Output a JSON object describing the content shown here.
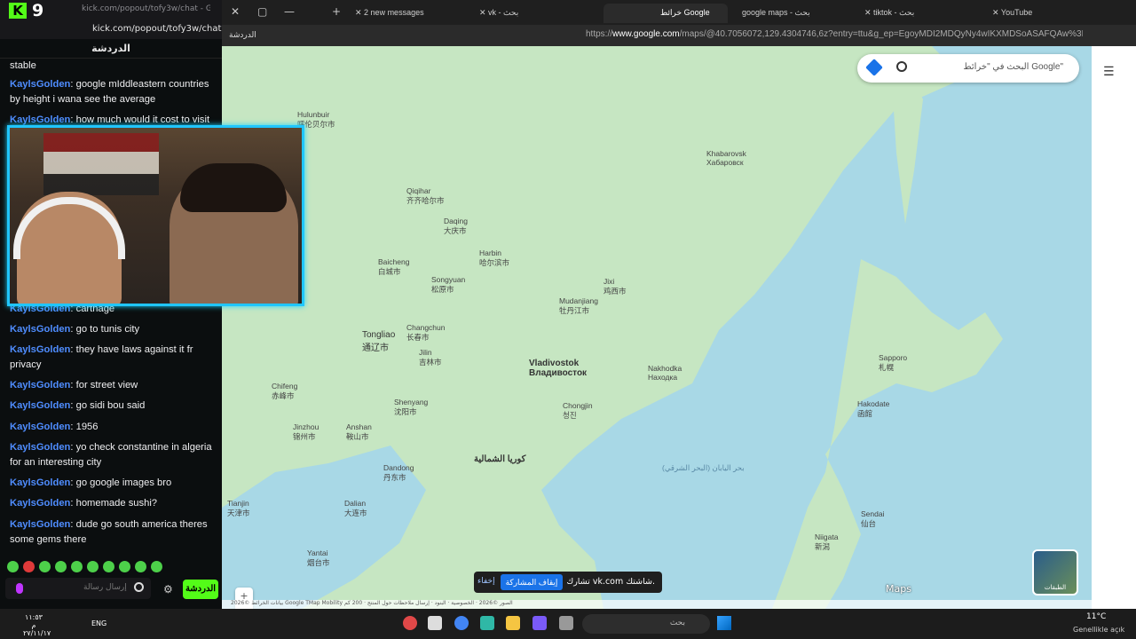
{
  "chat_window": {
    "viewer_count": "9",
    "title": "kick.com/popout/tofy3w/chat - Google...",
    "url": "kick.com/popout/tofy3w/chat",
    "header": "الدردشة",
    "messages": [
      {
        "user": "",
        "text": "stable"
      },
      {
        "user": "KaylsGolden",
        "text": "google mIddleastern countries by height i wana see the average"
      },
      {
        "user": "KaylsGolden",
        "text": "how much would it cost to visit"
      },
      {
        "user": "KaylsGolden",
        "text": "carthage"
      },
      {
        "user": "KaylsGolden",
        "text": "go to tunis city"
      },
      {
        "user": "KaylsGolden",
        "text": "they have laws against it fr privacy"
      },
      {
        "user": "KaylsGolden",
        "text": "for street view"
      },
      {
        "user": "KaylsGolden",
        "text": "go sidi bou said"
      },
      {
        "user": "KaylsGolden",
        "text": "1956"
      },
      {
        "user": "KaylsGolden",
        "text": "yo check constantine in algeria for an interesting city"
      },
      {
        "user": "KaylsGolden",
        "text": "go google images bro"
      },
      {
        "user": "KaylsGolden",
        "text": "homemade sushi?"
      },
      {
        "user": "KaylsGolden",
        "text": "dude go south america theres some gems there"
      }
    ],
    "input_placeholder": "إرسال رسالة",
    "send_label": "الدردشة"
  },
  "browser": {
    "tabs": [
      {
        "label": "2 new messages"
      },
      {
        "label": "vk - بحث"
      },
      {
        "label": "خرائط Google"
      },
      {
        "label": "google maps - بحث"
      },
      {
        "label": "tiktok - بحث"
      },
      {
        "label": "YouTube"
      }
    ],
    "url_prefix": "https://",
    "url_host": "www.google.com",
    "url_rest": "/maps/@40.7056072,129.4304746,6z?entry=ttu&g_ep=EgoyMDI2MDQyNy4wIKXMDSoASAFQAw%3D%3D",
    "profile_label": "الدردشة"
  },
  "map": {
    "search_placeholder": "البحث في \"خرائط Google\"",
    "layers_label": "الطبقات",
    "maps_logo": "Maps",
    "share_text": "تشارك vk.com شاشتك.",
    "share_stop": "إيقاف المشاركة",
    "share_hide": "إخفاء",
    "footer": "بيانات الخرائط ©2026 Google TMap Mobility الصور ©2026 · الخصوصية · البنود · إرسال ملاحظات حول المنتج · 200 كم",
    "places": [
      {
        "name": "Hulunbuir",
        "sub": "呼伦贝尔市"
      },
      {
        "name": "Qiqihar",
        "sub": "齐齐哈尔市"
      },
      {
        "name": "Daqing",
        "sub": "大庆市"
      },
      {
        "name": "Harbin",
        "sub": "哈尔滨市"
      },
      {
        "name": "Songyuan",
        "sub": "松原市"
      },
      {
        "name": "Baicheng",
        "sub": "白城市"
      },
      {
        "name": "Tongliao",
        "sub": "通辽市"
      },
      {
        "name": "Changchun",
        "sub": "长春市"
      },
      {
        "name": "Jilin",
        "sub": "吉林市"
      },
      {
        "name": "Chifeng",
        "sub": "赤峰市"
      },
      {
        "name": "Shenyang",
        "sub": "沈阳市"
      },
      {
        "name": "Jinzhou",
        "sub": "锦州市"
      },
      {
        "name": "Anshan",
        "sub": "鞍山市"
      },
      {
        "name": "Dandong",
        "sub": "丹东市"
      },
      {
        "name": "Dalian",
        "sub": "大连市"
      },
      {
        "name": "Tianjin",
        "sub": "天津市"
      },
      {
        "name": "Yantai",
        "sub": "烟台市"
      },
      {
        "name": "كوريا الشمالية",
        "sub": ""
      },
      {
        "name": "Vladivostok",
        "sub": "Владивосток"
      },
      {
        "name": "Khabarovsk",
        "sub": "Хабаровск"
      },
      {
        "name": "Sapporo",
        "sub": "札幌"
      },
      {
        "name": "Hakodate",
        "sub": "函館"
      },
      {
        "name": "Sendai",
        "sub": "仙台"
      },
      {
        "name": "Niigata",
        "sub": "新潟"
      },
      {
        "name": "Mudanjiang",
        "sub": "牡丹江市"
      },
      {
        "name": "Jixi",
        "sub": "鸡西市"
      },
      {
        "name": "Nakhodka",
        "sub": "Находка"
      },
      {
        "name": "Chongjin",
        "sub": "청진"
      },
      {
        "name": "بحر اليابان (البحر الشرقي)",
        "sub": ""
      }
    ]
  },
  "taskbar": {
    "time": "١١:٥٣ م",
    "date": "٢٧/١١/١٧",
    "lang": "ENG",
    "search_label": "بحث",
    "weather_temp": "11°C",
    "weather_desc": "Genellikle açık"
  },
  "colors": {
    "kick_green": "#53fc18",
    "username_blue": "#4f8dff",
    "webcam_border": "#20c6ff"
  }
}
